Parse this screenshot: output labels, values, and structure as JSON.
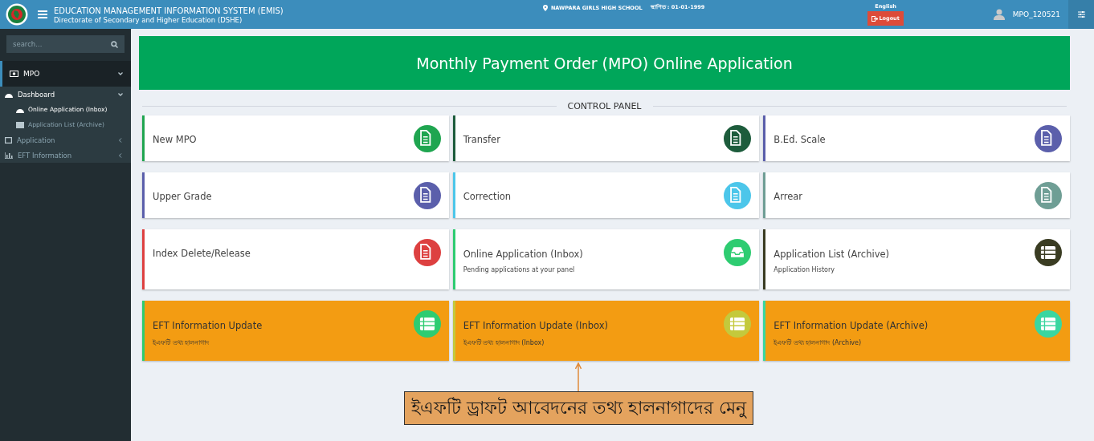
{
  "header": {
    "title": "EDUCATION MANAGEMENT INFORMATION SYSTEM (EMIS)",
    "subtitle": "Directorate of Secondary and Higher Education (DSHE)",
    "institute": "NAWPARA GIRLS HIGH SCHOOL",
    "established": "স্থাপিত : 01-01-1999",
    "language": "English",
    "logout": "Logout",
    "user": "MPO_120521"
  },
  "sidebar": {
    "search_placeholder": "search...",
    "items": [
      {
        "label": "MPO",
        "expanded": true,
        "children": [
          {
            "label": "Dashboard",
            "expanded": true,
            "children": [
              {
                "label": "Online Application (Inbox)",
                "selected": true
              },
              {
                "label": "Application List (Archive)",
                "selected": false
              }
            ]
          },
          {
            "label": "Application",
            "expanded": false
          },
          {
            "label": "EFT Information",
            "expanded": false
          }
        ]
      }
    ]
  },
  "banner": "Monthly Payment Order (MPO) Online Application",
  "section_title": "CONTROL PANEL",
  "cards": [
    {
      "kind": "document",
      "title": "New MPO",
      "color": "#1fa550"
    },
    {
      "kind": "document",
      "title": "Transfer",
      "color": "#1d5c3c"
    },
    {
      "kind": "document",
      "title": "B.Ed. Scale",
      "color": "#5b5fab"
    },
    {
      "kind": "document",
      "title": "Upper Grade",
      "color": "#5b5fab"
    },
    {
      "kind": "document",
      "title": "Correction",
      "color": "#4cc6ea"
    },
    {
      "kind": "document",
      "title": "Arrear",
      "color": "#6f9e95"
    },
    {
      "kind": "document",
      "title": "Index Delete/Release",
      "color": "#dd4040"
    },
    {
      "kind": "inbox",
      "title": "Online Application (Inbox)",
      "subtitle": "Pending applications at your panel",
      "color": "#2ecc71"
    },
    {
      "kind": "list",
      "title": "Application List (Archive)",
      "subtitle": "Application History",
      "color": "#3a3c22"
    },
    {
      "kind": "update",
      "title": "EFT Information Update",
      "subtitle": "ইএফটি তথ্য হালনাগাদ",
      "color": "#2ecc71"
    },
    {
      "kind": "update",
      "title": "EFT Information Update (Inbox)",
      "subtitle": "ইএফটি তথ্য হালনাগাদ (Inbox)",
      "color": "#c4c93c"
    },
    {
      "kind": "update",
      "title": "EFT Information Update (Archive)",
      "subtitle": "ইএফটি তথ্য হালনাগাদ (Archive)",
      "color": "#3ad6a0"
    }
  ],
  "annotation": "ইএফটি ড্রাফট আবেদনের তথ্য হালনাগাদের মেনু"
}
